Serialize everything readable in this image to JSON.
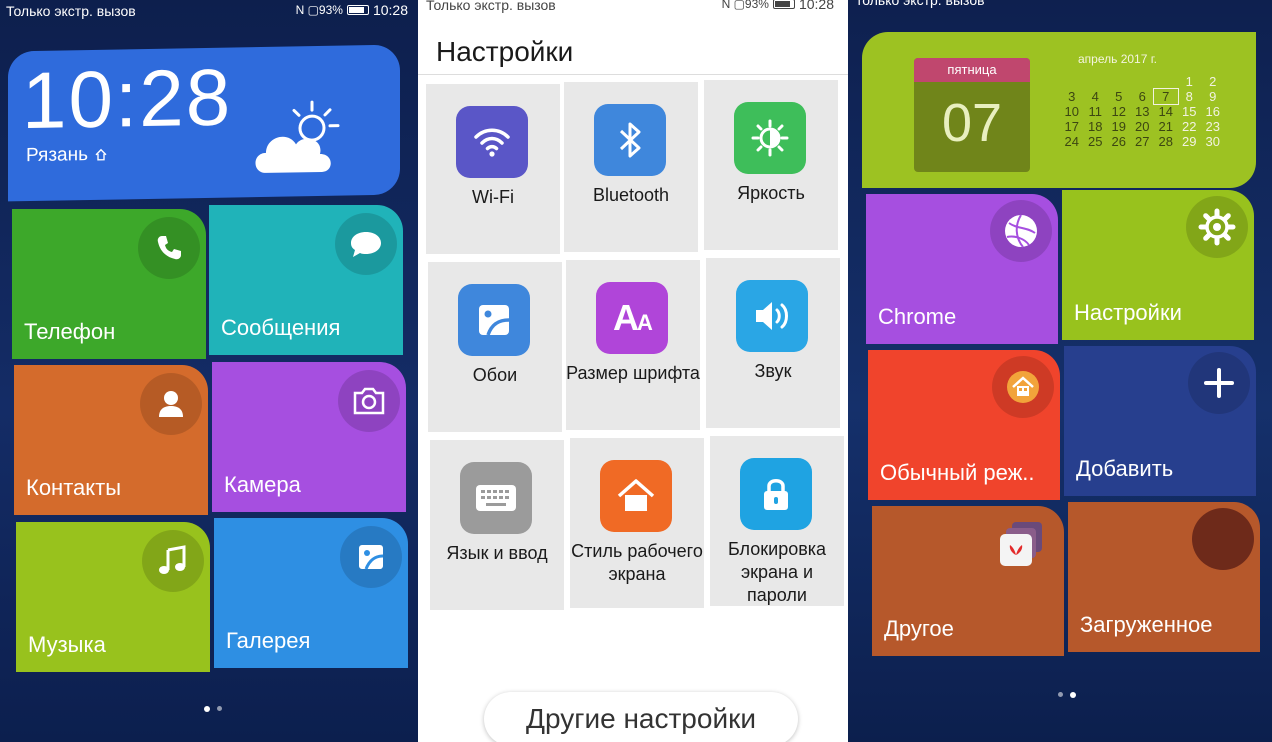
{
  "panel1": {
    "status": {
      "carrier": "Только экстр. вызов",
      "indicators": "N ▢93%",
      "time": "10:28"
    },
    "clock": {
      "time": "10:28",
      "city": "Рязань"
    },
    "tiles": [
      {
        "label": "Телефон",
        "color": "#3da82a"
      },
      {
        "label": "Сообщения",
        "color": "#20b3b9"
      },
      {
        "label": "Контакты",
        "color": "#d46b2c"
      },
      {
        "label": "Камера",
        "color": "#a64fe0"
      },
      {
        "label": "Музыка",
        "color": "#98c21d"
      },
      {
        "label": "Галерея",
        "color": "#2e8fe3"
      }
    ],
    "weather_color": "#2f6bdc"
  },
  "panel2": {
    "status": {
      "carrier": "Только экстр. вызов",
      "indicators": "N ▢93%",
      "time": "10:28"
    },
    "title": "Настройки",
    "items": [
      {
        "label": "Wi-Fi",
        "icon": "wifi-icon",
        "color": "#5a56c7"
      },
      {
        "label": "Bluetooth",
        "icon": "bluetooth-icon",
        "color": "#3f87dc"
      },
      {
        "label": "Яркость",
        "icon": "brightness-icon",
        "color": "#3ebe5a"
      },
      {
        "label": "Обои",
        "icon": "wallpaper-icon",
        "color": "#3f87dc"
      },
      {
        "label": "Размер шрифта",
        "icon": "font-size-icon",
        "color": "#b045d9"
      },
      {
        "label": "Звук",
        "icon": "sound-icon",
        "color": "#2aa6e5"
      },
      {
        "label": "Язык и ввод",
        "icon": "keyboard-icon",
        "color": "#9b9b9b"
      },
      {
        "label": "Стиль рабочего экрана",
        "icon": "home-style-icon",
        "color": "#f06a25"
      },
      {
        "label": "Блокировка экрана и пароли",
        "icon": "lock-icon",
        "color": "#1fa3e2"
      }
    ],
    "more_button": "Другие настройки"
  },
  "panel3": {
    "status": {
      "carrier": "только экстр. вызов"
    },
    "calendar": {
      "weekday": "пятница",
      "day": "07",
      "month": "апрель 2017 г.",
      "rows": [
        [
          "",
          "",
          "",
          "",
          "",
          "1",
          "2"
        ],
        [
          "3",
          "4",
          "5",
          "6",
          "7",
          "8",
          "9"
        ],
        [
          "10",
          "11",
          "12",
          "13",
          "14",
          "15",
          "16"
        ],
        [
          "17",
          "18",
          "19",
          "20",
          "21",
          "22",
          "23"
        ],
        [
          "24",
          "25",
          "26",
          "27",
          "28",
          "29",
          "30"
        ]
      ],
      "color": "#9dc222"
    },
    "tiles": [
      {
        "label": "Chrome",
        "color": "#a64fe0"
      },
      {
        "label": "Настройки",
        "color": "#98c21d"
      },
      {
        "label": "Обычный реж..",
        "color": "#f0442c"
      },
      {
        "label": "Добавить",
        "color": "#273f8e"
      },
      {
        "label": "Другое",
        "color": "#b6582b"
      },
      {
        "label": "Загруженное",
        "color": "#b6582b"
      }
    ]
  }
}
